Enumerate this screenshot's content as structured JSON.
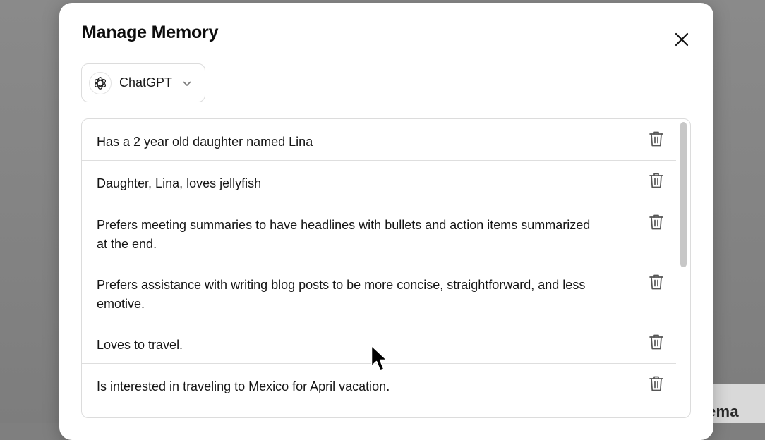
{
  "background": {
    "partial_text": "ema"
  },
  "dialog": {
    "title": "Manage Memory",
    "close_icon": "close-icon",
    "model_selector": {
      "label": "ChatGPT",
      "icon": "chatgpt-logo-icon",
      "chevron": "chevron-down-icon"
    }
  },
  "memories": [
    {
      "text": "Has a 2 year old daughter named Lina"
    },
    {
      "text": "Daughter, Lina, loves jellyfish"
    },
    {
      "text": "Prefers meeting summaries to have headlines with bullets and action items summarized at the end."
    },
    {
      "text": "Prefers assistance with writing blog posts to be more concise, straightforward, and less emotive."
    },
    {
      "text": "Loves to travel."
    },
    {
      "text": "Is interested in traveling to Mexico for April vacation."
    }
  ],
  "icons": {
    "delete": "trash-icon"
  },
  "colors": {
    "overlay": "#7f7f7f",
    "modal_bg": "#ffffff",
    "border": "#dcdcdc",
    "text": "#151515"
  }
}
